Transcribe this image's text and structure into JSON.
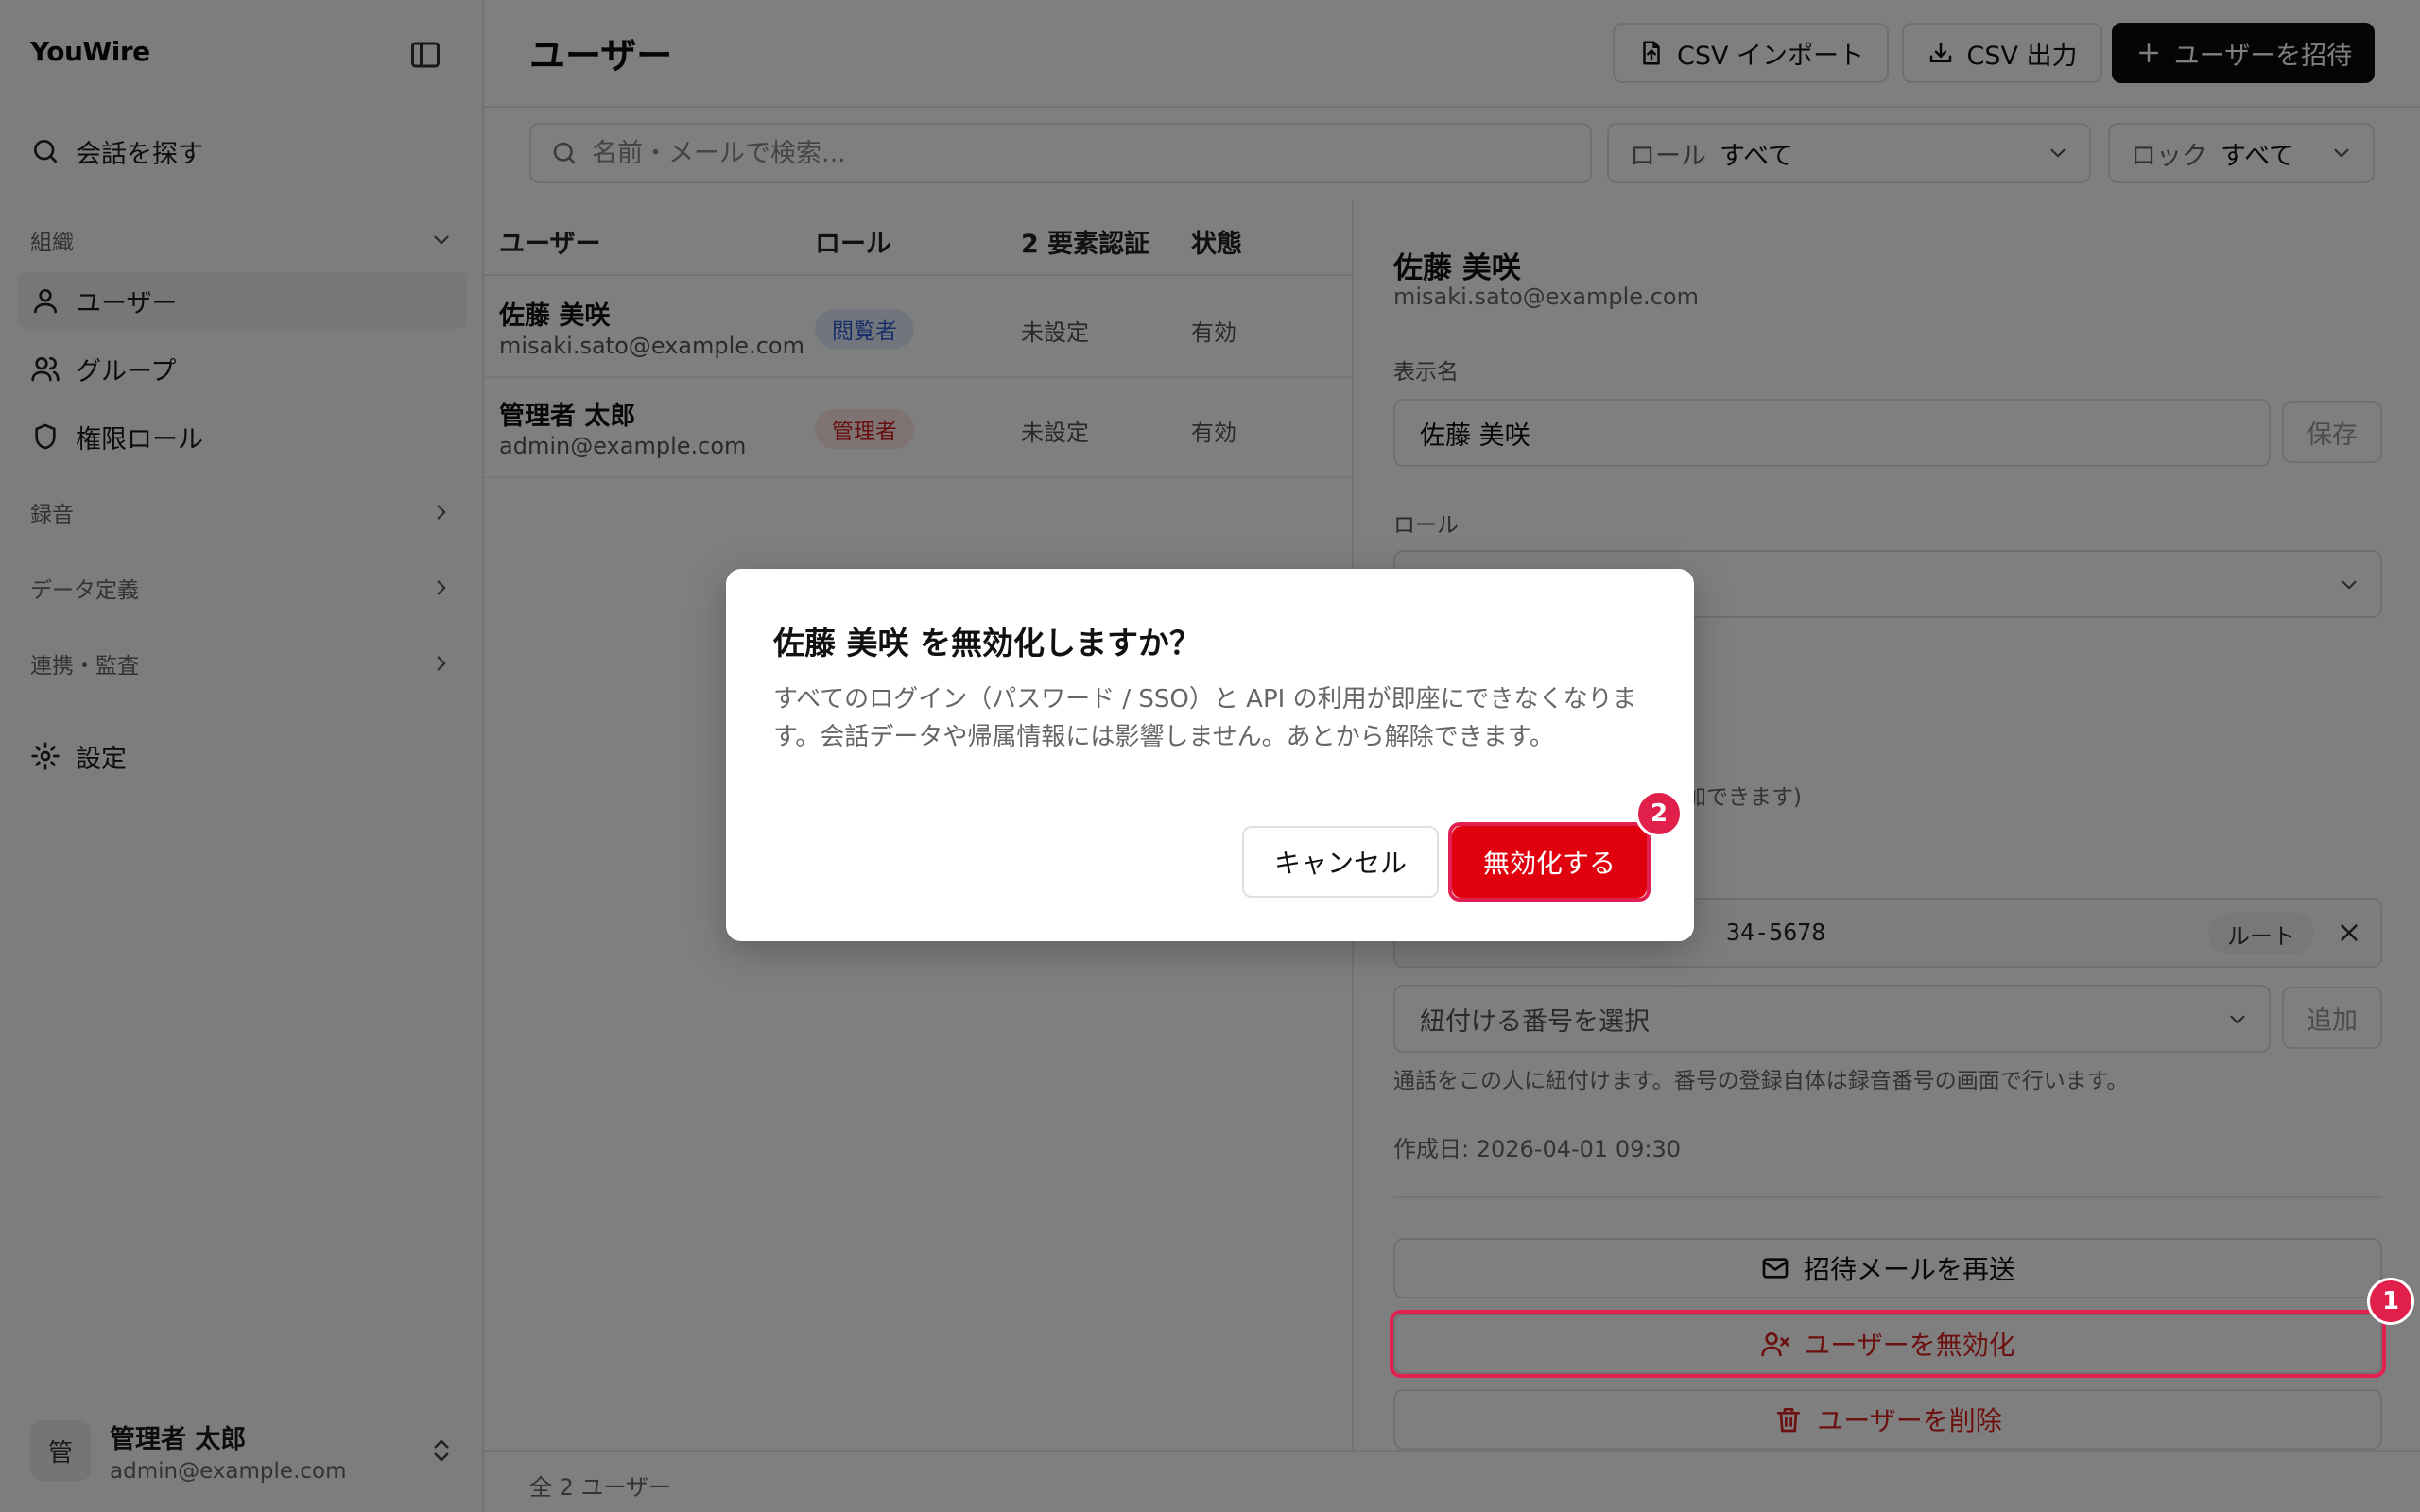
{
  "app": {
    "brand": "YouWire"
  },
  "sidebar": {
    "search_label": "会話を探す",
    "section_org": "組織",
    "items": [
      {
        "label": "ユーザー",
        "icon": "user-icon",
        "active": true
      },
      {
        "label": "グループ",
        "icon": "users-icon",
        "active": false
      },
      {
        "label": "権限ロール",
        "icon": "shield-icon",
        "active": false
      }
    ],
    "section_recording": "録音",
    "section_data": "データ定義",
    "section_integration": "連携・監査",
    "settings_label": "設定",
    "user": {
      "avatar": "管",
      "name": "管理者 太郎",
      "email": "admin@example.com"
    }
  },
  "header": {
    "title": "ユーザー",
    "csv_import": "CSV インポート",
    "csv_export": "CSV 出力",
    "invite": "ユーザーを招待"
  },
  "filters": {
    "search_placeholder": "名前・メールで検索...",
    "role_label": "ロール",
    "role_value": "すべて",
    "lock_label": "ロック",
    "lock_value": "すべて"
  },
  "table": {
    "columns": [
      "ユーザー",
      "ロール",
      "2 要素認証",
      "状態"
    ],
    "rows": [
      {
        "name": "佐藤 美咲",
        "email": "misaki.sato@example.com",
        "role": "閲覧者",
        "role_color": "#2f5fd0",
        "role_bg": "#e3ecfb",
        "twofa": "未設定",
        "status": "有効"
      },
      {
        "name": "管理者 太郎",
        "email": "admin@example.com",
        "role": "管理者",
        "role_color": "#d02020",
        "role_bg": "#fde4e4",
        "twofa": "未設定",
        "status": "有効"
      }
    ]
  },
  "footer": {
    "count": "全 2 ユーザー"
  },
  "detail": {
    "name": "佐藤 美咲",
    "email": "misaki.sato@example.com",
    "display_name_label": "表示名",
    "display_name_value": "佐藤 美咲",
    "save": "保存",
    "role_label": "ロール",
    "hidden_help": "加できます)",
    "phone_number_fragment": "34-5678",
    "phone_badge": "ルート",
    "phone_select_placeholder": "紐付ける番号を選択",
    "add": "追加",
    "phone_help": "通話をこの人に紐付けます。番号の登録自体は録音番号の画面で行います。",
    "created": "作成日: 2026-04-01 09:30",
    "resend_invite": "招待メールを再送",
    "disable_user": "ユーザーを無効化",
    "delete_user": "ユーザーを削除"
  },
  "modal": {
    "title": "佐藤 美咲 を無効化しますか？",
    "body": "すべてのログイン（パスワード / SSO）と API の利用が即座にできなくなります。会話データや帰属情報には影響しません。あとから解除できます。",
    "cancel": "キャンセル",
    "confirm": "無効化する"
  },
  "markers": [
    "1",
    "2"
  ],
  "colors": {
    "danger": "#e0000e",
    "marker": "#e0204a",
    "primary": "#0a0a0a"
  }
}
